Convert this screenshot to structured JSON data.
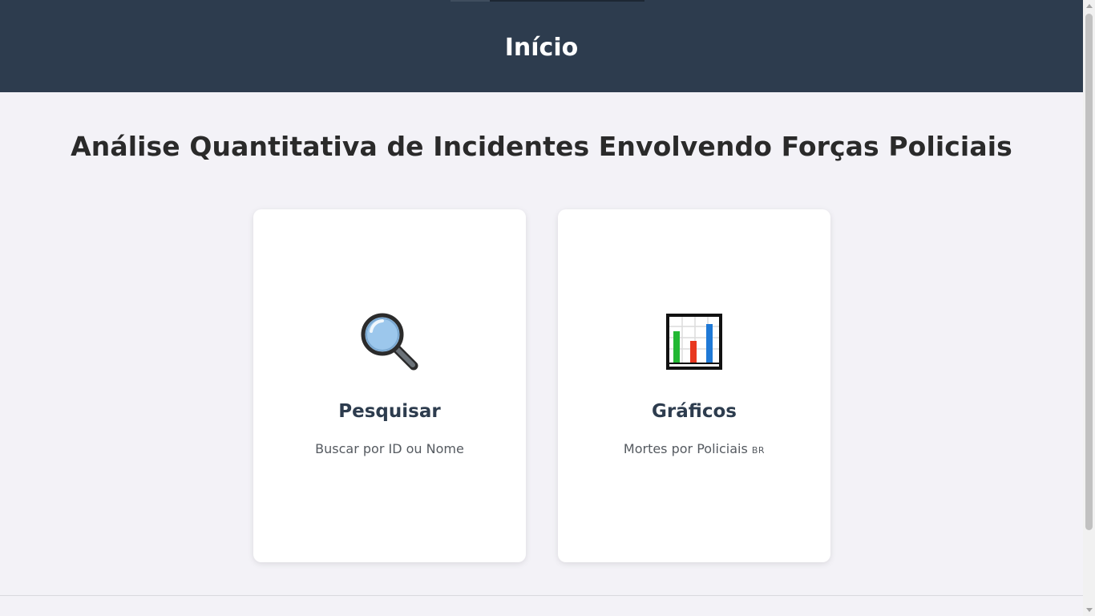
{
  "header": {
    "title": "Início"
  },
  "main": {
    "title": "Análise Quantitativa de Incidentes Envolvendo Forças Policiais"
  },
  "cards": [
    {
      "icon": "magnifying-glass-icon",
      "title": "Pesquisar",
      "subtitle": "Buscar por ID ou Nome"
    },
    {
      "icon": "bar-chart-icon",
      "title": "Gráficos",
      "subtitle": "Mortes por Policiais",
      "subtitle_suffix": "BR"
    }
  ],
  "colors": {
    "header_bg": "#2d3c4e",
    "page_bg": "#f3f2f7",
    "card_bg": "#ffffff",
    "card_title": "#2d3c4e"
  }
}
